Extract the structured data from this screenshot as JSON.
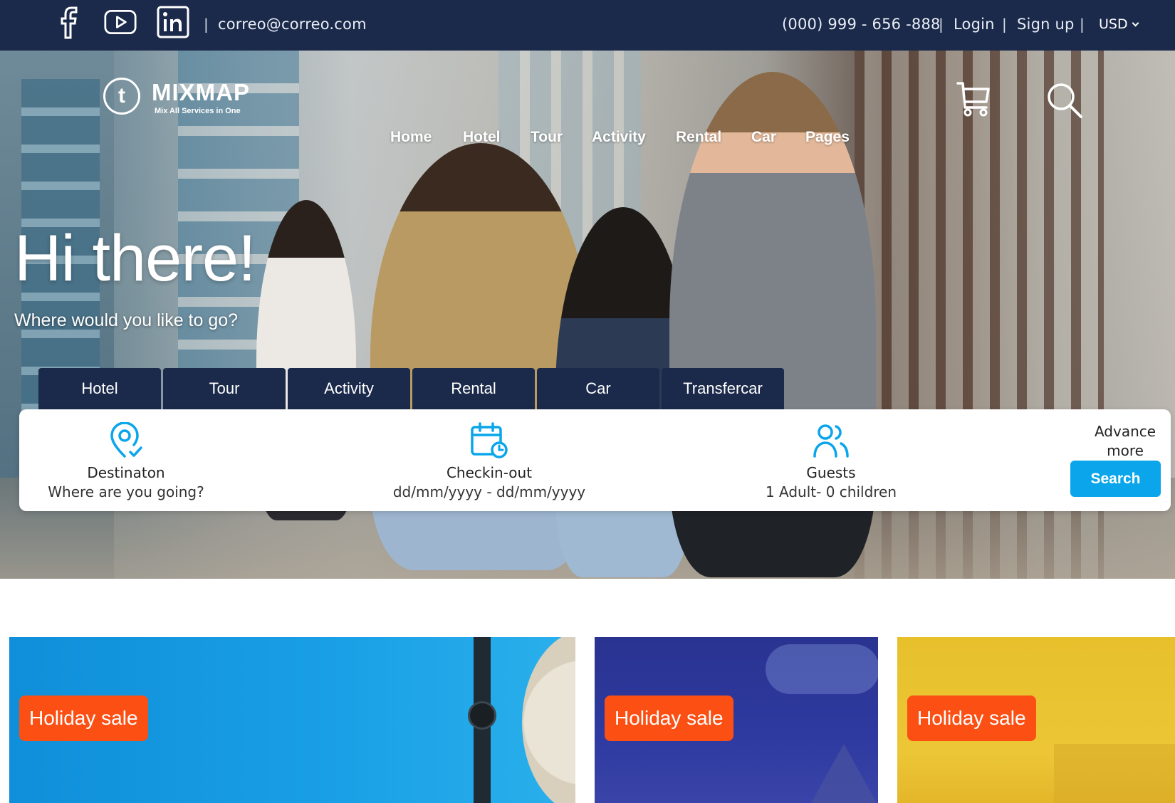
{
  "topbar": {
    "social": [
      {
        "name": "facebook-icon"
      },
      {
        "name": "youtube-icon"
      },
      {
        "name": "linkedin-icon"
      }
    ],
    "email": "correo@correo.com",
    "phone": "(000) 999 - 656 -888",
    "login": "Login",
    "signup": "Sign up",
    "currency": "USD",
    "separator": "|"
  },
  "brand": {
    "logo_letter": "t",
    "name": "MIXMAP",
    "tagline": "Mix All Services in One"
  },
  "nav": {
    "items": [
      "Home",
      "Hotel",
      "Tour",
      "Activity",
      "Rental",
      "Car",
      "Pages"
    ],
    "cart_icon": "cart-icon",
    "search_icon": "search-icon"
  },
  "hero": {
    "title": "Hi there!",
    "subtitle": "Where would you like to go?"
  },
  "tabs": [
    "Hotel",
    "Tour",
    "Activity",
    "Rental",
    "Car",
    "Transfercar"
  ],
  "search": {
    "destination_label": "Destinaton",
    "destination_value": "Where are you going?",
    "checkout_label": "Checkin-out",
    "checkout_value": "dd/mm/yyyy - dd/mm/yyyy",
    "guests_label": "Guests",
    "guests_value": "1 Adult- 0 children",
    "advance_label": "Advance more",
    "button_label": "Search"
  },
  "promos": [
    {
      "badge": "Holiday sale"
    },
    {
      "badge": "Holiday sale"
    },
    {
      "badge": "Holiday sale"
    }
  ],
  "colors": {
    "topbar": "#1b2a4a",
    "tab": "#1b2a4a",
    "accent": "#0aa5ea",
    "badge": "#fb4f14",
    "card1": "#0f97e0",
    "card2": "#2a3390",
    "card3": "#e8c12e"
  }
}
